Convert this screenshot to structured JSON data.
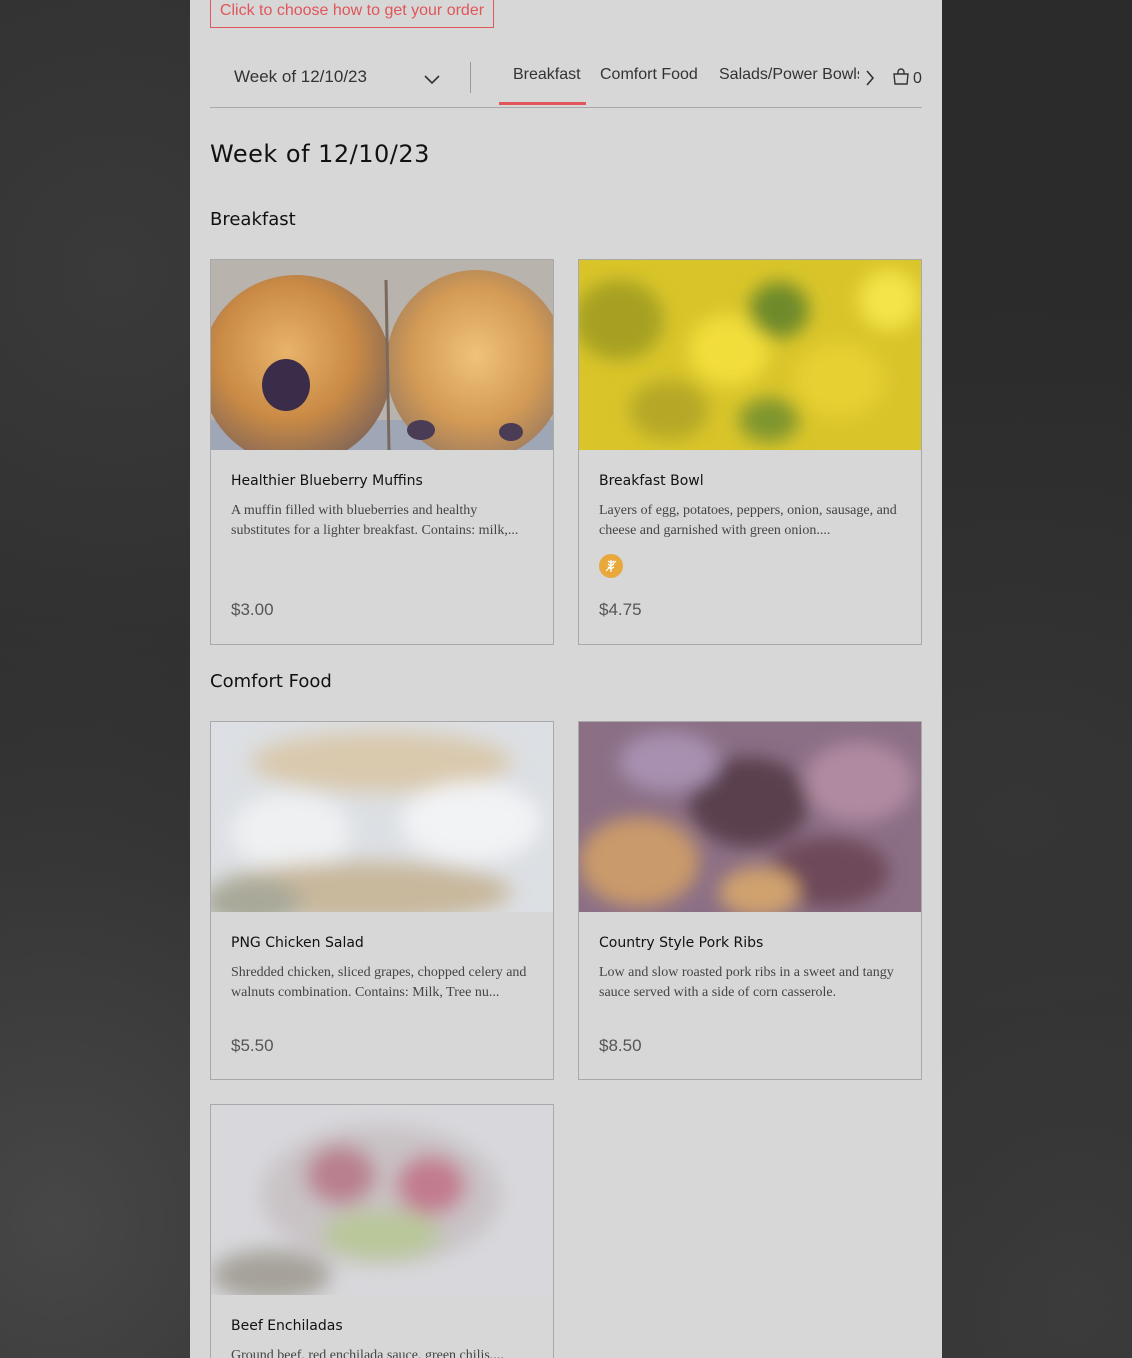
{
  "header": {
    "order_button": "Click to choose how to get your order",
    "week_select": "Week of 12/10/23",
    "tabs": [
      "Breakfast",
      "Comfort Food",
      "Salads/Power Bowls"
    ],
    "active_tab": "Breakfast",
    "cart_count": "0"
  },
  "page_title": "Week of 12/10/23",
  "sections": [
    {
      "title": "Breakfast",
      "items": [
        {
          "name": "Healthier Blueberry Muffins",
          "description": "A muffin filled with blueberries and healthy substitutes for a lighter breakfast. Contains: milk,...",
          "price": "$3.00",
          "image": "blueberry-muffins-photo"
        },
        {
          "name": "Breakfast Bowl",
          "description": "Layers of egg, potatoes, peppers, onion, sausage, and cheese and garnished with green onion....",
          "price": "$4.75",
          "badge_icon": "gluten-free-icon",
          "image": "breakfast-bowl-photo"
        }
      ]
    },
    {
      "title": "Comfort Food",
      "items": [
        {
          "name": "PNG Chicken Salad",
          "description": "Shredded chicken, sliced grapes, chopped celery and walnuts combination. Contains: Milk, Tree nu...",
          "price": "$5.50",
          "image": "chicken-salad-photo"
        },
        {
          "name": "Country Style Pork Ribs",
          "description": "Low and slow roasted pork ribs in a sweet and tangy sauce served with a side of corn casserole.",
          "price": "$8.50",
          "image": "pork-ribs-photo"
        },
        {
          "name": "Beef Enchiladas",
          "description": "Ground beef, red enchilada sauce, green chilis,...",
          "image": "beef-enchiladas-photo"
        }
      ]
    }
  ],
  "colors": {
    "accent": "#e0565a",
    "panel": "#d7d7d7",
    "badge": "#e9a83c"
  }
}
